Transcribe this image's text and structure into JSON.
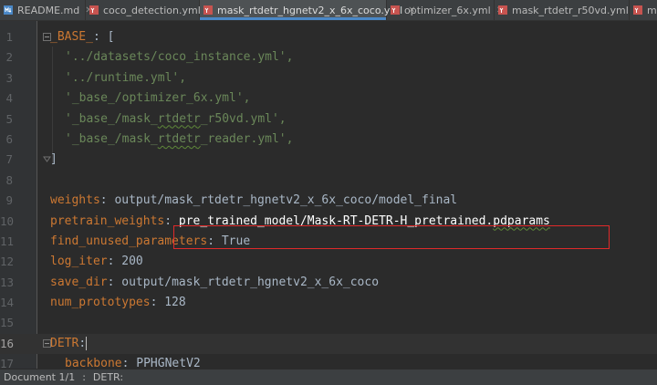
{
  "tabs": [
    {
      "label": "README.md",
      "icon": "markdown-file-icon",
      "icon_color": "#4a88c7",
      "active": false
    },
    {
      "label": "coco_detection.yml",
      "icon": "yaml-file-icon",
      "icon_color": "#c75450",
      "active": false
    },
    {
      "label": "mask_rtdetr_hgnetv2_x_6x_coco.yml",
      "icon": "yaml-file-icon",
      "icon_color": "#c75450",
      "active": true
    },
    {
      "label": "optimizer_6x.yml",
      "icon": "yaml-file-icon",
      "icon_color": "#c75450",
      "active": false
    },
    {
      "label": "mask_rtdetr_r50vd.yml",
      "icon": "yaml-file-icon",
      "icon_color": "#c75450",
      "active": false
    },
    {
      "label": "ma",
      "icon": "yaml-file-icon",
      "icon_color": "#c75450",
      "active": false
    }
  ],
  "editor": {
    "line_numbers": [
      "1",
      "2",
      "3",
      "4",
      "5",
      "6",
      "7",
      "8",
      "9",
      "10",
      "11",
      "12",
      "13",
      "14",
      "15",
      "16",
      "17"
    ],
    "lines": {
      "l1_key": "_BASE_",
      "l1_rest": ": [",
      "l2": "'../datasets/coco_instance.yml',",
      "l3": "'../runtime.yml',",
      "l4a": "'_base_/optimizer_6x.yml',",
      "l5a": "'_base_/mask_",
      "l5b": "rtdetr",
      "l5c": "_r50vd.yml',",
      "l6a": "'_base_/mask_",
      "l6b": "rtdetr",
      "l6c": "_reader.yml',",
      "l7": "]",
      "l9_key": "weights",
      "l9_val": ": output/mask_rtdetr_hgnetv2_x_6x_coco/model_final",
      "l10_key": "pretrain_weights",
      "l10_colon": ":",
      "l10_val_a": " pre_trained_model/Mask-RT-DETR-H_pretrained.",
      "l10_val_b": "pdparams",
      "l11_key": "find_unused_parameters",
      "l11_val": ": True",
      "l12_key": "log_iter",
      "l12_val": ": 200",
      "l13_key": "save_dir",
      "l13_val": ": output/mask_rtdetr_hgnetv2_x_6x_coco",
      "l14_key": "num_prototypes",
      "l14_val": ": 128",
      "l16_key": "DETR",
      "l16_rest": ":",
      "l17_key": "backbone",
      "l17_val": ": PPHGNetV2"
    },
    "current_line": "16",
    "highlight_color": "#e02a2a"
  },
  "status": {
    "document": "Document 1/1",
    "separator": ":",
    "breadcrumb": "DETR:"
  }
}
